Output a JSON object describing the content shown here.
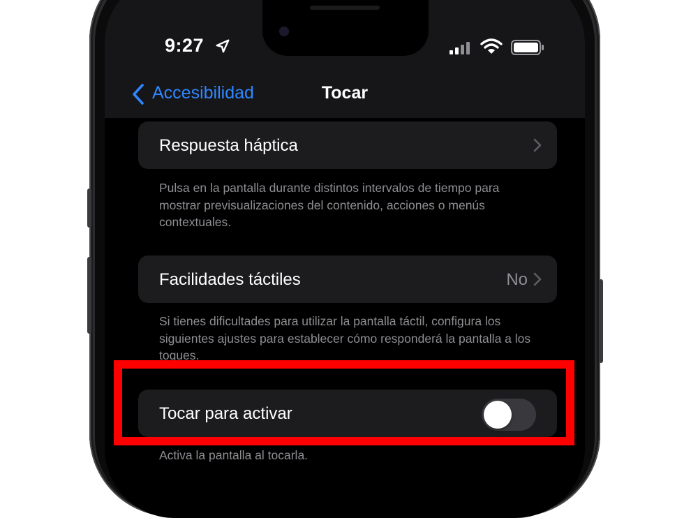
{
  "status_bar": {
    "time": "9:27"
  },
  "nav": {
    "back_label": "Accesibilidad",
    "title": "Tocar"
  },
  "cells": {
    "haptic": {
      "label": "Respuesta háptica"
    },
    "haptic_footer": "Pulsa en la pantalla durante distintos intervalos de tiempo para mostrar previsualizaciones del contenido, acciones o menús contextuales.",
    "accommodations": {
      "label": "Facilidades táctiles",
      "value": "No"
    },
    "accommodations_footer": "Si tienes dificultades para utilizar la pantalla táctil, configura los siguientes ajustes para establecer cómo responderá la pantalla a los toques.",
    "tap_to_wake": {
      "label": "Tocar para activar",
      "enabled": false
    },
    "tap_to_wake_footer": "Activa la pantalla al tocarla."
  },
  "colors": {
    "accent": "#2f86ff",
    "highlight": "#ff0000",
    "cell_background": "#1c1c1e",
    "secondary_text": "#8e8e93"
  },
  "icons": {
    "status": [
      "location-icon",
      "signal-icon",
      "wifi-icon",
      "battery-icon"
    ],
    "navigation": [
      "chevron-left-icon",
      "chevron-right-icon"
    ]
  }
}
